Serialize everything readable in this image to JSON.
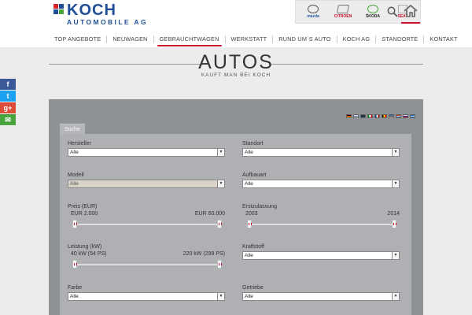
{
  "logo": {
    "name": "KOCH",
    "sub": "AUTOMOBILE AG"
  },
  "brands": [
    {
      "name": "mazda-logo",
      "label": "mazda"
    },
    {
      "name": "citroen-logo",
      "label": "CITROËN"
    },
    {
      "name": "skoda-logo",
      "label": "ŠKODA"
    },
    {
      "name": "seat-logo",
      "label": "SEAT"
    }
  ],
  "nav": [
    {
      "label": "TOP ANGEBOTE"
    },
    {
      "label": "NEUWAGEN"
    },
    {
      "label": "GEBRAUCHTWAGEN",
      "active": true
    },
    {
      "label": "WERKSTATT"
    },
    {
      "label": "RUND UM´S AUTO"
    },
    {
      "label": "KOCH AG"
    },
    {
      "label": "STANDORTE"
    },
    {
      "label": "KONTAKT"
    }
  ],
  "hero": {
    "title": "AUTOS",
    "subtitle": "KAUFT MAN BEI KOCH"
  },
  "social": {
    "facebook": "f",
    "twitter": "t",
    "googleplus": "g+",
    "mail": "✉"
  },
  "panel": {
    "tab": "Suche",
    "flags": [
      "de",
      "fi",
      "gb",
      "it",
      "fr",
      "be",
      "ee",
      "nl",
      "ru",
      "gr"
    ],
    "fields": {
      "hersteller": {
        "label": "Hersteller",
        "value": "Alle"
      },
      "standort": {
        "label": "Standort",
        "value": "Alle"
      },
      "modell": {
        "label": "Modell",
        "value": "Alle",
        "disabled": true
      },
      "aufbauart": {
        "label": "Aufbauart",
        "value": "Alle"
      },
      "preis": {
        "label": "Preis (EUR)",
        "min": "EUR 2.000",
        "max": "EUR 60.000",
        "range_fraction": [
          0,
          1
        ]
      },
      "erstzulassung": {
        "label": "Erstzulassung",
        "min": "2003",
        "max": "2014",
        "range_fraction": [
          0,
          1
        ]
      },
      "leistung": {
        "label": "Leistung (kW)",
        "min": "40 kW (54 PS)",
        "max": "220 kW (299 PS)",
        "range_fraction": [
          0,
          1
        ]
      },
      "kraftstoff": {
        "label": "Kraftstoff",
        "value": "Alle"
      },
      "farbe": {
        "label": "Farbe",
        "value": "Alle"
      },
      "getriebe": {
        "label": "Getriebe",
        "value": "Alle"
      }
    }
  },
  "colors": {
    "accent": "#c8102e",
    "brand_blue": "#1f4e96",
    "panel": "#8e9196",
    "form": "#aeb0b4"
  }
}
